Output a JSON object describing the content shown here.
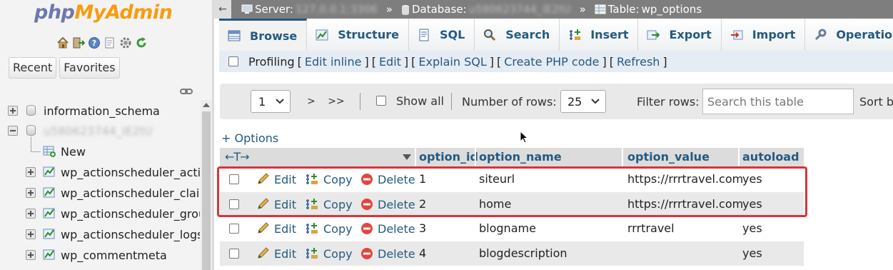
{
  "app": {
    "logo_part1": "php",
    "logo_part2": "MyAdmin"
  },
  "nav": {
    "icons": [
      "home-icon",
      "exit-icon",
      "help-icon",
      "docs-icon",
      "settings-icon",
      "reload-icon"
    ],
    "tabs": [
      "Recent",
      "Favorites"
    ],
    "databases": [
      {
        "name": "information_schema",
        "expanded": false
      },
      {
        "name": "u580623744_iE2tU",
        "expanded": true,
        "obscured": true
      }
    ],
    "new_label": "New",
    "tables": [
      "wp_actionscheduler_actions",
      "wp_actionscheduler_claims",
      "wp_actionscheduler_groups",
      "wp_actionscheduler_logs",
      "wp_commentmeta"
    ]
  },
  "breadcrumb": {
    "server_label": "Server:",
    "server_value": "127.0.0.1:3306",
    "database_label": "Database:",
    "database_value": "u580623744_iE2tU",
    "table_label": "Table:",
    "table_value": "wp_options",
    "separator": "»"
  },
  "tabs": [
    "Browse",
    "Structure",
    "SQL",
    "Search",
    "Insert",
    "Export",
    "Import",
    "Operations"
  ],
  "profiling": {
    "label": "Profiling",
    "links": [
      "Edit inline",
      "Edit",
      "Explain SQL",
      "Create PHP code",
      "Refresh"
    ],
    "open": "[",
    "close": "]"
  },
  "pager": {
    "page_value": "1",
    "next": ">",
    "last": ">>",
    "show_all": "Show all",
    "rows_label": "Number of rows:",
    "rows_value": "25",
    "filter_label": "Filter rows:",
    "filter_placeholder": "Search this table",
    "sort_label": "Sort by"
  },
  "table": {
    "options_link": "+ Options",
    "arrows": "←T→",
    "columns": [
      "option_id",
      "option_name",
      "option_value",
      "autoload"
    ],
    "action_labels": {
      "edit": "Edit",
      "copy": "Copy",
      "delete": "Delete"
    },
    "rows": [
      {
        "id": "1",
        "name": "siteurl",
        "value": "https://rrrtravel.com",
        "autoload": "yes"
      },
      {
        "id": "2",
        "name": "home",
        "value": "https://rrrtravel.com",
        "autoload": "yes"
      },
      {
        "id": "3",
        "name": "blogname",
        "value": "rrrtravel",
        "autoload": "yes"
      },
      {
        "id": "4",
        "name": "blogdescription",
        "value": "",
        "autoload": "yes"
      }
    ]
  },
  "colors": {
    "link": "#235a81",
    "highlight": "#d9343a",
    "logo_blue": "#6c78af",
    "logo_orange": "#f89c0e",
    "topbar": "#7e7e7e"
  }
}
